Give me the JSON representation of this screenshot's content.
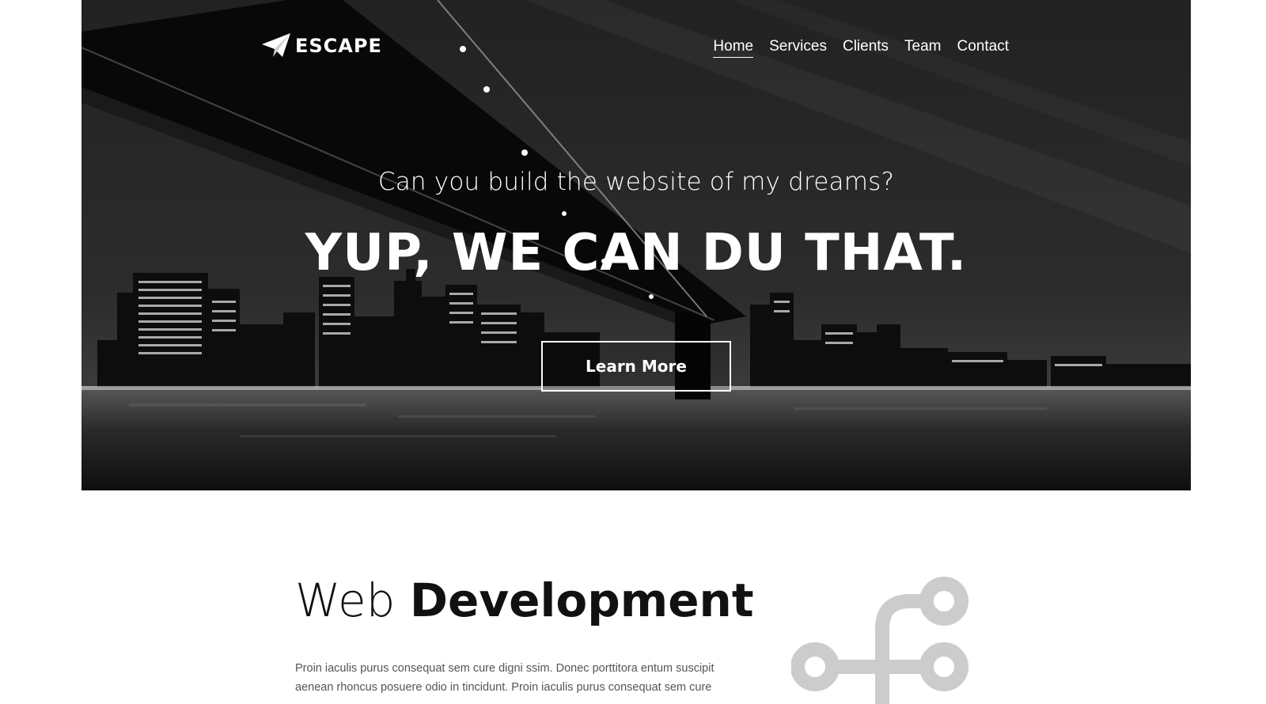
{
  "brand": {
    "name": "ESCAPE",
    "logo_icon": "paper-plane-icon"
  },
  "nav": {
    "items": [
      {
        "label": "Home",
        "active": true
      },
      {
        "label": "Services",
        "active": false
      },
      {
        "label": "Clients",
        "active": false
      },
      {
        "label": "Team",
        "active": false
      },
      {
        "label": "Contact",
        "active": false
      }
    ]
  },
  "hero": {
    "subtitle": "Can you build the website of my dreams?",
    "title": "YUP, WE CAN DU THAT.",
    "button_label": "Learn More"
  },
  "section": {
    "title_light": "Web",
    "title_bold": "Development",
    "body": "Proin iaculis purus consequat sem cure digni ssim. Donec porttitora entum suscipit aenean rhoncus posuere odio in tincidunt. Proin iaculis purus consequat sem cure",
    "icon": "git-branch-icon"
  },
  "colors": {
    "icon_gray": "#cccccc",
    "text_dark": "#111111",
    "body_text": "#555555"
  }
}
